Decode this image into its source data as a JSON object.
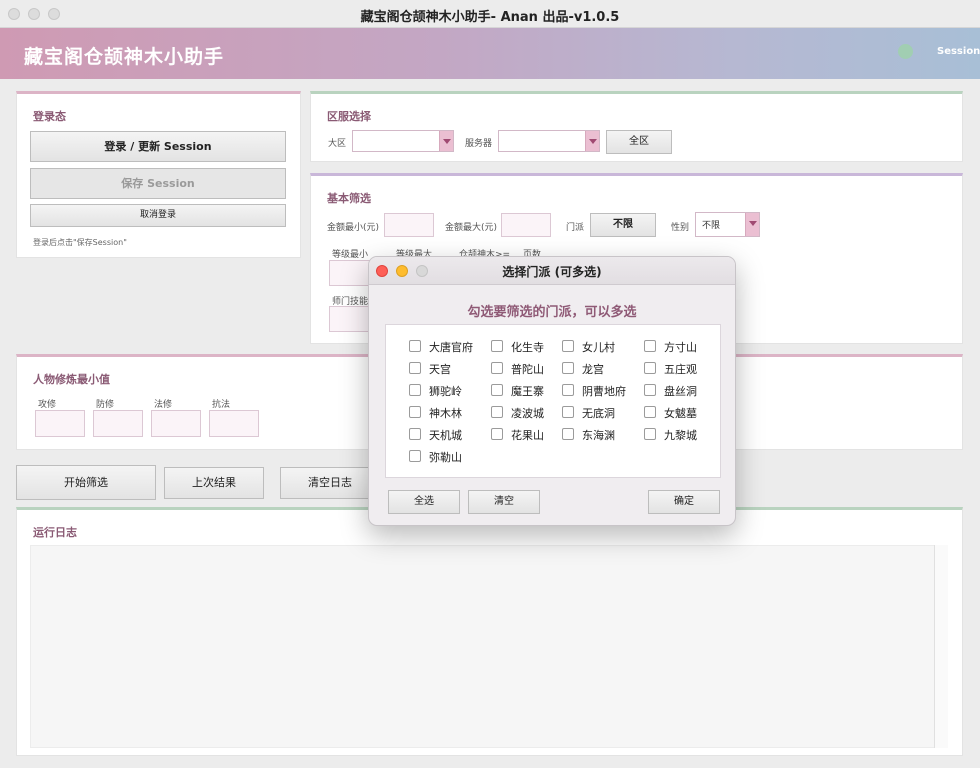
{
  "window": {
    "title": "藏宝阁仓颉神木小助手- Anan 出品-v1.0.5"
  },
  "banner": {
    "app_title": "藏宝阁仓颉神木小助手",
    "session_label": "Session"
  },
  "login": {
    "title": "登录态",
    "login_button": "登录 / 更新 Session",
    "save_button": "保存 Session",
    "logout_button": "取消登录",
    "hint": "登录后点击\"保存Session\""
  },
  "region": {
    "title": "区服选择",
    "area_label": "大区",
    "area_value": "",
    "server_label": "服务器",
    "server_value": "",
    "all_button": "全区"
  },
  "filter": {
    "title": "基本筛选",
    "price_min_label": "金额最小(元)",
    "price_max_label": "金额最大(元)",
    "school_label": "门派",
    "school_button": "不限",
    "gender_label": "性别",
    "gender_value": "不限",
    "level_min_label": "等级最小",
    "level_max_label": "等级最大",
    "wood_label": "仓颉神木>=",
    "pages_label": "页数",
    "skill_label": "师门技能"
  },
  "cultivation": {
    "title": "人物修炼最小值",
    "labels": [
      "攻修",
      "防修",
      "法修",
      "抗法"
    ]
  },
  "actions": {
    "start": "开始筛选",
    "last": "上次结果",
    "clear_log": "清空日志"
  },
  "log": {
    "title": "运行日志"
  },
  "dialog": {
    "title": "选择门派 (可多选)",
    "heading": "勾选要筛选的门派，可以多选",
    "options": [
      "大唐官府",
      "化生寺",
      "女儿村",
      "方寸山",
      "天宫",
      "普陀山",
      "龙宫",
      "五庄观",
      "狮驼岭",
      "魔王寨",
      "阴曹地府",
      "盘丝洞",
      "神木林",
      "凌波城",
      "无底洞",
      "女魃墓",
      "天机城",
      "花果山",
      "东海渊",
      "九黎城",
      "弥勒山"
    ],
    "select_all": "全选",
    "clear": "清空",
    "confirm": "确定"
  },
  "colors": {
    "accent": "#8a5a74",
    "banner_start": "#cf9ab3",
    "banner_end": "#a8bfd6",
    "close": "#fe5f57",
    "minimize": "#febc2e"
  }
}
